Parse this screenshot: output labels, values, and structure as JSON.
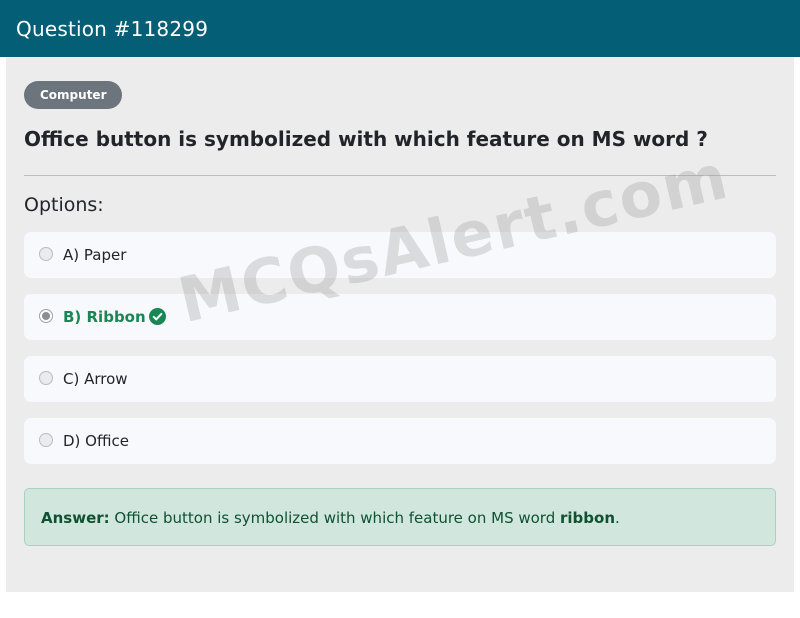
{
  "header": {
    "title": "Question #118299",
    "background": "#045f76"
  },
  "question": {
    "category": "Computer",
    "text": "Office button is symbolized with which feature on MS word ?"
  },
  "options": {
    "heading": "Options:",
    "items": [
      {
        "label": "A) Paper",
        "selected": false,
        "correct": false
      },
      {
        "label": "B) Ribbon",
        "selected": true,
        "correct": true
      },
      {
        "label": "C) Arrow",
        "selected": false,
        "correct": false
      },
      {
        "label": "D) Office",
        "selected": false,
        "correct": false
      }
    ]
  },
  "answer": {
    "label": "Answer:",
    "text": " Office button is symbolized with which feature on MS word ",
    "word": "ribbon",
    "suffix": "."
  },
  "watermark": "MCQsAlert.com",
  "colors": {
    "correct": "#198754",
    "answer_bg": "#d1e7dd",
    "badge": "#6c757d"
  }
}
